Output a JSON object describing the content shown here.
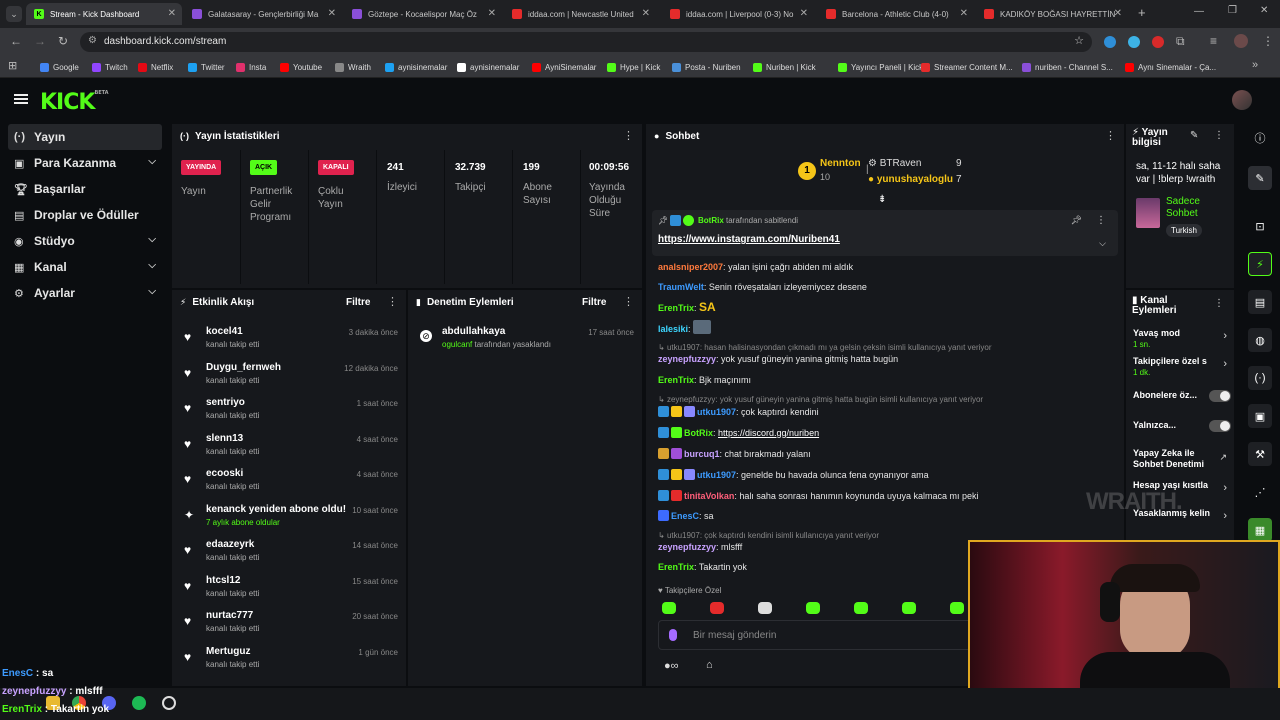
{
  "browser": {
    "tabs": [
      {
        "title": "Stream - Kick Dashboard",
        "color": "#53fc18",
        "icon": "K"
      },
      {
        "title": "Galatasaray - Gençlerbirliği Ma",
        "color": "#8a4fd8",
        "icon": ""
      },
      {
        "title": "Göztepe - Kocaelispor Maç Öz",
        "color": "#8a4fd8",
        "icon": ""
      },
      {
        "title": "iddaa.com | Newcastle United",
        "color": "#e52b2b",
        "icon": ""
      },
      {
        "title": "iddaa.com | Liverpool (0-3) No",
        "color": "#e52b2b",
        "icon": ""
      },
      {
        "title": "Barcelona - Athletic Club (4-0)",
        "color": "#e52b2b",
        "icon": ""
      },
      {
        "title": "KADIKÖY BOĞASI HAYRETTİN",
        "color": "#e52b2b",
        "icon": ""
      }
    ],
    "url": "dashboard.kick.com/stream",
    "bookmarks": [
      {
        "label": "Google",
        "color": "#4285f4"
      },
      {
        "label": "Twitch",
        "color": "#9146ff"
      },
      {
        "label": "Netflix",
        "color": "#e50914"
      },
      {
        "label": "Twitter",
        "color": "#1da1f2"
      },
      {
        "label": "Insta",
        "color": "#e1306c"
      },
      {
        "label": "Youtube",
        "color": "#ff0000"
      },
      {
        "label": "Wraith",
        "color": "#888888"
      },
      {
        "label": "aynisinemalar",
        "color": "#1da1f2"
      },
      {
        "label": "aynisinemalar",
        "color": "#ffffff"
      },
      {
        "label": "AyniSinemalar",
        "color": "#ff0000"
      },
      {
        "label": "Hype | Kick",
        "color": "#53fc18"
      },
      {
        "label": "Posta - Nuriben",
        "color": "#4a90d9"
      },
      {
        "label": "Nuriben | Kick",
        "color": "#53fc18"
      },
      {
        "label": "Yayıncı Paneli | Kick",
        "color": "#53fc18"
      },
      {
        "label": "Streamer Content M...",
        "color": "#e52b2b"
      },
      {
        "label": "nuriben - Channel S...",
        "color": "#8a4fd8"
      },
      {
        "label": "Aynı Sinemalar - Ça...",
        "color": "#ff0000"
      }
    ]
  },
  "sidebar": {
    "items": [
      {
        "label": "Yayın",
        "icon": "broadcast-icon"
      },
      {
        "label": "Para Kazanma",
        "icon": "money-icon"
      },
      {
        "label": "Başarılar",
        "icon": "trophy-icon"
      },
      {
        "label": "Droplar ve Ödüller",
        "icon": "gift-icon"
      },
      {
        "label": "Stüdyo",
        "icon": "studio-icon"
      },
      {
        "label": "Kanal",
        "icon": "channel-icon"
      },
      {
        "label": "Ayarlar",
        "icon": "gear-icon"
      }
    ]
  },
  "stats": {
    "title": "Yayın İstatistikleri",
    "items": [
      {
        "badge": "YAYINDA",
        "badge_color": "#e0224e",
        "label": "Yayın"
      },
      {
        "badge": "AÇIK",
        "badge_color": "#53fc18",
        "label": "Partnerlik Gelir Programı"
      },
      {
        "badge": "KAPALI",
        "badge_color": "#e0224e",
        "label": "Çoklu Yayın"
      },
      {
        "value": "241",
        "label": "İzleyici"
      },
      {
        "value": "32.739",
        "label": "Takipçi"
      },
      {
        "value": "199",
        "label": "Abone Sayısı"
      },
      {
        "value": "00:09:56",
        "label": "Yayında Olduğu Süre"
      }
    ]
  },
  "activity": {
    "title": "Etkinlik Akışı",
    "filter": "Filtre",
    "items": [
      {
        "name": "kocel41",
        "sub": "kanalı takip etti",
        "time": "3 dakika önce"
      },
      {
        "name": "Duygu_fernweh",
        "sub": "kanalı takip etti",
        "time": "12 dakika önce"
      },
      {
        "name": "sentriyo",
        "sub": "kanalı takip etti",
        "time": "1 saat önce"
      },
      {
        "name": "slenn13",
        "sub": "kanalı takip etti",
        "time": "4 saat önce"
      },
      {
        "name": "ecooski",
        "sub": "kanalı takip etti",
        "time": "4 saat önce"
      },
      {
        "name": "kenanck yeniden abone oldu!",
        "sub": "7 aylık abone oldular",
        "time": "10 saat önce"
      },
      {
        "name": "edaazeyrk",
        "sub": "kanalı takip etti",
        "time": "14 saat önce"
      },
      {
        "name": "htcsl12",
        "sub": "kanalı takip etti",
        "time": "15 saat önce"
      },
      {
        "name": "nurtac777",
        "sub": "kanalı takip etti",
        "time": "20 saat önce"
      },
      {
        "name": "Mertuguz",
        "sub": "kanalı takip etti",
        "time": "1 gün önce"
      }
    ]
  },
  "moderation": {
    "title": "Denetim Eylemleri",
    "filter": "Filtre",
    "item": {
      "name": "abdullahkaya",
      "by": "ogulcanf",
      "action": "tarafından yasaklandı",
      "time": "17 saat önce"
    }
  },
  "chat": {
    "title": "Sohbet",
    "leaders": [
      {
        "rank": "1",
        "name": "Nennton",
        "count": "10"
      },
      {
        "name": "BTRaven",
        "count": "9"
      },
      {
        "name": "yunushayaloglu",
        "count": "7"
      }
    ],
    "pinned": {
      "by": "BotRix",
      "by_text": "tarafından sabitlendi",
      "link": "https://www.instagram.com/Nuriben41"
    },
    "messages": [
      {
        "user": "analsniper2007",
        "color": "#ff7a3d",
        "text": "yalan işini çağrı abiden mi aldık"
      },
      {
        "user": "TraumWelt",
        "color": "#3d9bff",
        "text": "Senin röveşataları izleyemiycez desene"
      },
      {
        "user": "ErenTrix",
        "color": "#53fc18",
        "text": "SA"
      },
      {
        "user": "lalesiki",
        "color": "#3dd6ff",
        "text": ""
      },
      {
        "reply": "utku1907: hasan halisinasyondan çıkmadı mı ya gelsin çeksin isimli kullanıcıya yanıt veriyor"
      },
      {
        "user": "zeynepfuzzyy",
        "color": "#c8a2ff",
        "text": "yok yusuf güneyin yanina gitmiş hatta bugün"
      },
      {
        "user": "ErenTrix",
        "color": "#53fc18",
        "text": "Bjk maçınımı"
      },
      {
        "reply": "zeynepfuzzyy: yok yusuf güneyin yanina gitmiş hatta bugün isimli kullanıcıya yanıt veriyor"
      },
      {
        "user": "utku1907",
        "color": "#3d9bff",
        "text": "çok kaptırdı kendini"
      },
      {
        "user": "BotRix",
        "color": "#53fc18",
        "text": "https://discord.gg/nuriben"
      },
      {
        "user": "burcuq1",
        "color": "#c8a2ff",
        "text": "chat bırakmadı yalanı"
      },
      {
        "user": "utku1907",
        "color": "#3d9bff",
        "text": "genelde bu havada olunca fena oynanıyor ama"
      },
      {
        "user": "tinitaVolkan",
        "color": "#ff5f7a",
        "text": "halı saha sonrası hanımın koynunda uyuya kalmaca mı peki"
      },
      {
        "user": "EnesC",
        "color": "#3d9bff",
        "text": "sa"
      },
      {
        "reply": "utku1907: çok kaptırdı kendini isimli kullanıcıya yanıt veriyor"
      },
      {
        "user": "zeynepfuzzyy",
        "color": "#c8a2ff",
        "text": "mlsfff"
      },
      {
        "user": "ErenTrix",
        "color": "#53fc18",
        "text": "Takartin yok"
      }
    ],
    "followers_only": "Takipçilere Özel",
    "input_placeholder": "Bir mesaj gönderin"
  },
  "stream_info": {
    "title": "Yayın bilgisi",
    "text": "sa, 11-12 halı saha var | !blerp !wraith",
    "category": "Sadece Sohbet",
    "tag": "Turkish"
  },
  "channel_actions": {
    "title": "Kanal Eylemleri",
    "items": [
      {
        "label": "Yavaş mod",
        "sub": "1 sn.",
        "type": "arrow"
      },
      {
        "label": "Takipçilere özel s",
        "sub": "1 dk.",
        "type": "arrow"
      },
      {
        "label": "Abonelere öz...",
        "type": "toggle"
      },
      {
        "label": "Yalnızca...",
        "type": "toggle"
      },
      {
        "label": "Yapay Zeka ile Sohbet Denetimi",
        "type": "link"
      },
      {
        "label": "Hesap yaşı kısıtla",
        "type": "arrow"
      },
      {
        "label": "Yasaklanmış kelin",
        "type": "arrow"
      }
    ]
  },
  "overlay": {
    "watermark": "WRAITH.",
    "chat": [
      {
        "user": "EnesC",
        "text": "sa",
        "color": "#3d9bff"
      },
      {
        "user": "zeynepfuzzyy",
        "text": "mlsfff",
        "color": "#c8a2ff"
      },
      {
        "user": "ErenTrix",
        "text": "Takartin yok",
        "color": "#53fc18"
      }
    ]
  },
  "colors": {
    "kick_green": "#53fc18",
    "panel_bg": "#16181c",
    "page_bg": "#0b0d10"
  }
}
